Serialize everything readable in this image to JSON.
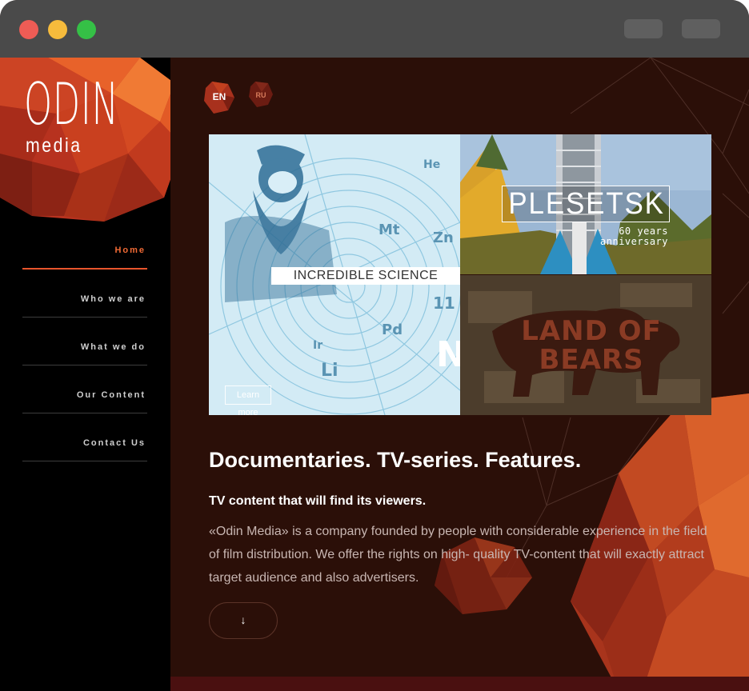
{
  "brand": {
    "name": "ODIN",
    "tagline": "media"
  },
  "nav": {
    "items": [
      {
        "label": "Home",
        "active": true
      },
      {
        "label": "Who we are"
      },
      {
        "label": "What we do"
      },
      {
        "label": "Our Content"
      },
      {
        "label": "Contact Us"
      }
    ]
  },
  "languages": [
    "EN",
    "RU"
  ],
  "tiles": {
    "science": {
      "title": "INCREDIBLE SCIENCE",
      "cta": "Learn more"
    },
    "plesetsk": {
      "title": "PLESETSK",
      "subtitle_line1": "60 years",
      "subtitle_line2": "anniversary"
    },
    "bears": {
      "title": "LAND OF BEARS"
    }
  },
  "hero": {
    "headline": "Documentaries. TV-series. Features.",
    "subheadline": "TV content that will find its viewers.",
    "paragraph": "«Odin Media» is a company founded by people with considerable experience in the field of film distribution. We offer the rights on high- quality TV-content that will exactly attract target audience and also advertisers.",
    "scroll_icon": "↓"
  },
  "colors": {
    "accent": "#e8552c",
    "background": "#2b0f08",
    "sidebar": "#000000"
  }
}
